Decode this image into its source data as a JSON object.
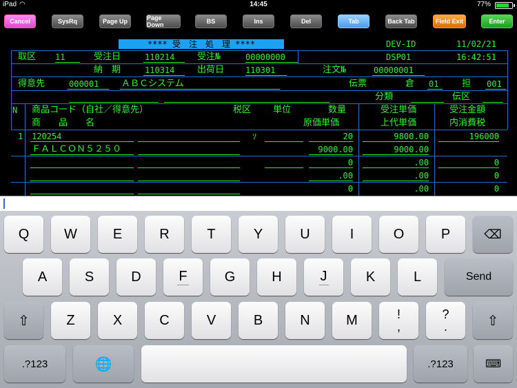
{
  "status": {
    "device": "iPad",
    "time": "14:45",
    "battery": "77%"
  },
  "toolbar": {
    "buttons": [
      "Cancel",
      "SysRq",
      "Page Up",
      "Page Down",
      "BS",
      "Ins",
      "Del",
      "Tab",
      "Back Tab",
      "Field Exit",
      "Enter"
    ]
  },
  "screen": {
    "title": "**** 受　注　処　理 ****",
    "dev_label": "DEV-ID",
    "date": "11/02/21",
    "dsp_label": "DSP01",
    "clock": "16:42:51",
    "r1": {
      "l1": "取区",
      "v1": "11",
      "l2": "受注日",
      "v2": "110214",
      "l3": "受注№",
      "v3": "00000000"
    },
    "r2": {
      "l1": "納　期",
      "v1": "110314",
      "l2": "出荷日",
      "v2": "110301",
      "l3": "注文№",
      "v3": "00000001"
    },
    "r3": {
      "l1": "得意先",
      "v1": "000001",
      "v2": "ＡＢＣシステム",
      "l3": "伝票",
      "l4": "倉",
      "v4": "01",
      "l5": "担",
      "v5": "001"
    },
    "r4": {
      "l1": "分類",
      "l2": "伝区"
    },
    "hdr": {
      "n": "N",
      "c1": "商品コード（自社／得意先）",
      "c2": "税区",
      "c3": "単位",
      "c4": "数量",
      "c5": "受注単価",
      "c6": "受注金額",
      "c1b": "商　　品　　名",
      "c4b": "原価単価",
      "c5b": "上代単価",
      "c6b": "内消費税"
    },
    "line1": {
      "no": "1",
      "code": "120254",
      "tax": "ｿ",
      "qty": "20",
      "price": "9800.00",
      "amount": "196000",
      "name": "ＦＡＬＣＯＮ５２５０",
      "cost": "9000.00",
      "retail": "9000.00"
    },
    "line2": {
      "qty": "0",
      "price": ".00",
      "amount": "0",
      "cost": ".00",
      "retail": ".00",
      "tax": "0"
    },
    "line3": {
      "qty": "0",
      "price": ".00",
      "amount": "0"
    }
  },
  "keyboard": {
    "row1": [
      "Q",
      "W",
      "E",
      "R",
      "T",
      "Y",
      "U",
      "I",
      "O",
      "P"
    ],
    "row2": [
      "A",
      "S",
      "D",
      "F",
      "G",
      "H",
      "J",
      "K",
      "L"
    ],
    "row3": [
      "Z",
      "X",
      "C",
      "V",
      "B",
      "N",
      "M"
    ],
    "send": "Send",
    "num": ".?123",
    "excl_top": "!",
    "excl_bot": ",",
    "q_top": "?",
    "q_bot": "."
  }
}
